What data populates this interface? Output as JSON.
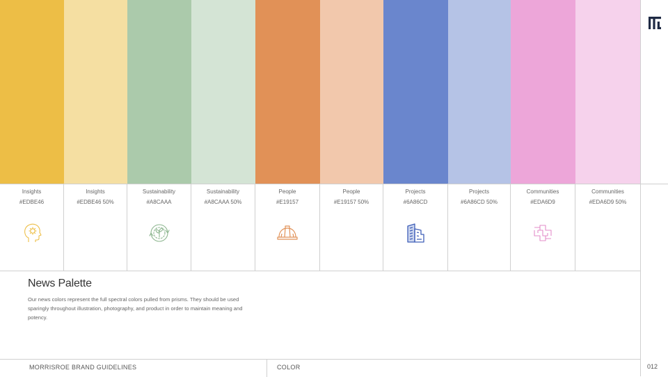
{
  "palette": [
    {
      "name": "Insights",
      "hex_label": "#EDBE46",
      "color": "#EDBE46",
      "icon": "head-gear-icon"
    },
    {
      "name": "Insights",
      "hex_label": "#EDBE46 50%",
      "color": "#F5DFA2",
      "icon": ""
    },
    {
      "name": "Sustainability",
      "hex_label": "#A8CAAA",
      "color": "#ABCAAB",
      "icon": "recycle-circle-icon"
    },
    {
      "name": "Sustainability",
      "hex_label": "#A8CAAA 50%",
      "color": "#D4E4D5",
      "icon": ""
    },
    {
      "name": "People",
      "hex_label": "#E19157",
      "color": "#E19157",
      "icon": "hard-hat-icon"
    },
    {
      "name": "People",
      "hex_label": "#E19157 50%",
      "color": "#F2C8AC",
      "icon": ""
    },
    {
      "name": "Projects",
      "hex_label": "#6A86CD",
      "color": "#6A86CD",
      "icon": "building-icon"
    },
    {
      "name": "Projects",
      "hex_label": "#6A86CD 50%",
      "color": "#B5C3E6",
      "icon": ""
    },
    {
      "name": "Communities",
      "hex_label": "#EDA6D9",
      "color": "#EDA6D9",
      "icon": "joined-hands-icon"
    },
    {
      "name": "Communities",
      "hex_label": "#EDA6D9 50%",
      "color": "#F6D2EC",
      "icon": ""
    }
  ],
  "section": {
    "title": "News Palette",
    "description": "Our news colors represent the full spectral colors pulled from prisms. They should be used sparingly throughout illustration, photography, and product in order to maintain meaning and potency."
  },
  "footer": {
    "brand": "MORRISROE BRAND GUIDELINES",
    "section_label": "COLOR",
    "page_number": "012"
  },
  "logo": {
    "icon": "morrisroe-logo-icon",
    "color": "#1F2A44"
  }
}
